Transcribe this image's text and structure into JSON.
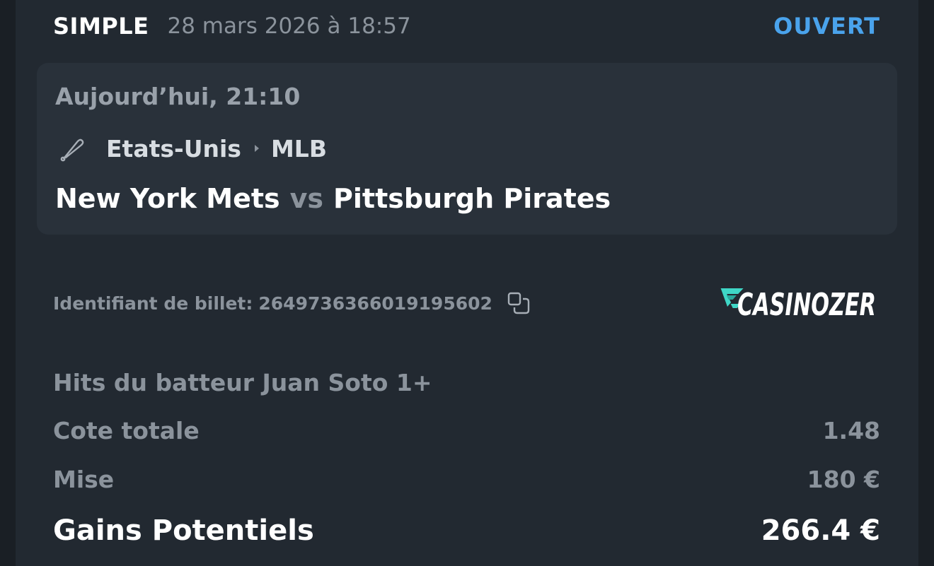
{
  "header": {
    "bet_type": "SIMPLE",
    "date": "28 mars 2026 à 18:57",
    "status": "OUVERT"
  },
  "event": {
    "time": "Aujourd’hui, 21:10",
    "sport_icon": "baseball-bat-icon",
    "country": "Etats-Unis",
    "separator_icon": "chevron-right-icon",
    "league": "MLB",
    "home_team": "New York Mets",
    "vs": "vs",
    "away_team": "Pittsburgh Pirates"
  },
  "ticket": {
    "id_label": "Identifiant de billet:",
    "id_value": "2649736366019195602",
    "copy_icon": "copy-icon"
  },
  "brand": {
    "logo_text": "CASINOZER",
    "logo_accent": "#3fd6c6"
  },
  "selection": {
    "label": "Hits du batteur Juan Soto 1+"
  },
  "summary": {
    "odds_label": "Cote totale",
    "odds_value": "1.48",
    "stake_label": "Mise",
    "stake_value": "180 €",
    "gains_label": "Gains Potentiels",
    "gains_value": "266.4 €"
  },
  "colors": {
    "background": "#222931",
    "card": "#29313a",
    "status": "#4aa3ec",
    "muted_text": "#8b939c",
    "primary_text": "#ffffff"
  }
}
